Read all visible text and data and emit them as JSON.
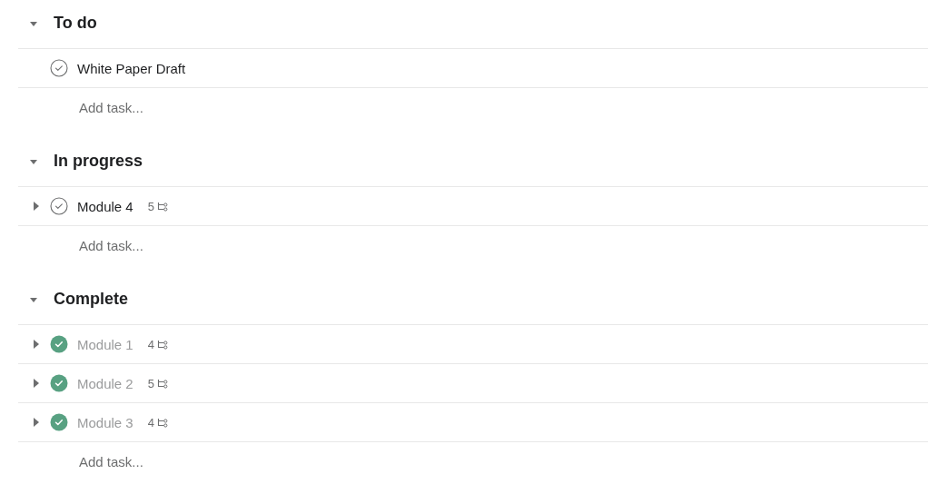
{
  "sections": [
    {
      "title": "To do",
      "expanded": true,
      "add_label": "Add task...",
      "tasks": [
        {
          "name": "White Paper Draft",
          "completed": false,
          "has_subtasks": false
        }
      ]
    },
    {
      "title": "In progress",
      "expanded": true,
      "add_label": "Add task...",
      "tasks": [
        {
          "name": "Module 4",
          "completed": false,
          "has_subtasks": true,
          "subtask_count": "5"
        }
      ]
    },
    {
      "title": "Complete",
      "expanded": true,
      "add_label": "Add task...",
      "tasks": [
        {
          "name": "Module 1",
          "completed": true,
          "has_subtasks": true,
          "subtask_count": "4"
        },
        {
          "name": "Module 2",
          "completed": true,
          "has_subtasks": true,
          "subtask_count": "5"
        },
        {
          "name": "Module 3",
          "completed": true,
          "has_subtasks": true,
          "subtask_count": "4"
        }
      ]
    }
  ]
}
